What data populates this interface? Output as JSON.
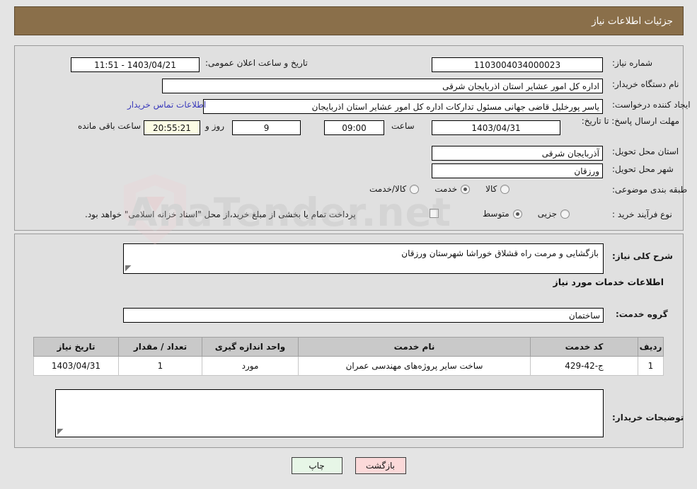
{
  "header": {
    "title": "جزئیات اطلاعات نیاز"
  },
  "fields": {
    "need_number_label": "شماره نیاز:",
    "need_number_value": "1103004034000023",
    "announce_label": "تاریخ و ساعت اعلان عمومی:",
    "announce_value": "1403/04/21 - 11:51",
    "buyer_org_label": "نام دستگاه خریدار:",
    "buyer_org_value": "اداره کل امور عشایر استان اذربایجان شرقی",
    "creator_label": "ایجاد کننده درخواست:",
    "creator_value": "یاسر پورخلیل قاضی جهانی مسئول تدارکات اداره کل امور عشایر استان اذربایجان",
    "contact_link": "اطلاعات تماس خریدار",
    "deadline_label": "مهلت ارسال پاسخ: تا تاریخ:",
    "deadline_date": "1403/04/31",
    "deadline_time_label": "ساعت",
    "deadline_time": "09:00",
    "days_remaining": "9",
    "days_unit": "روز و",
    "time_remaining": "20:55:21",
    "time_remaining_suffix": "ساعت باقی مانده",
    "province_label": "استان محل تحویل:",
    "province_value": "آذربایجان شرقی",
    "city_label": "شهر محل تحویل:",
    "city_value": "ورزقان",
    "category_label": "طبقه بندی موضوعی:",
    "process_label": "نوع فرآیند خرید :",
    "treasury_note": "پرداخت تمام یا بخشی از مبلغ خرید،از محل \"اسناد خزانه اسلامی\" خواهد بود."
  },
  "category_options": [
    {
      "label": "کالا",
      "selected": false
    },
    {
      "label": "خدمت",
      "selected": true
    },
    {
      "label": "کالا/خدمت",
      "selected": false
    }
  ],
  "process_options": [
    {
      "label": "جزیی",
      "selected": false
    },
    {
      "label": "متوسط",
      "selected": true
    }
  ],
  "treasury_checkbox_checked": false,
  "description": {
    "label": "شرح کلی نیاز:",
    "value": "بازگشایی و مرمت راه قشلاق خوراشا شهرستان ورزقان"
  },
  "services_section": {
    "heading": "اطلاعات خدمات مورد نیاز",
    "group_label": "گروه خدمت:",
    "group_value": "ساختمان"
  },
  "table": {
    "headers": [
      "ردیف",
      "کد خدمت",
      "نام خدمت",
      "واحد اندازه گیری",
      "تعداد / مقدار",
      "تاریخ نیاز"
    ],
    "rows": [
      {
        "row": "1",
        "code": "ج-42-429",
        "name": "ساخت سایر پروژه‌های مهندسی عمران",
        "unit": "مورد",
        "qty": "1",
        "need_date": "1403/04/31"
      }
    ]
  },
  "buyer_notes": {
    "label": "توضیحات خریدار:",
    "value": ""
  },
  "buttons": {
    "print": "چاپ",
    "back": "بازگشت"
  },
  "watermark": {
    "text": "AnaTender.net"
  },
  "colors": {
    "header_bg": "#8a6f4a",
    "panel_bg": "#e0e0e0",
    "page_bg": "#e4e4e4",
    "link": "#3b3bbb",
    "countdown_bg": "#fbfbe4",
    "print_btn_bg": "#e7f6e7",
    "back_btn_bg": "#fbd9d9",
    "table_header_bg": "#c9c9c9"
  }
}
